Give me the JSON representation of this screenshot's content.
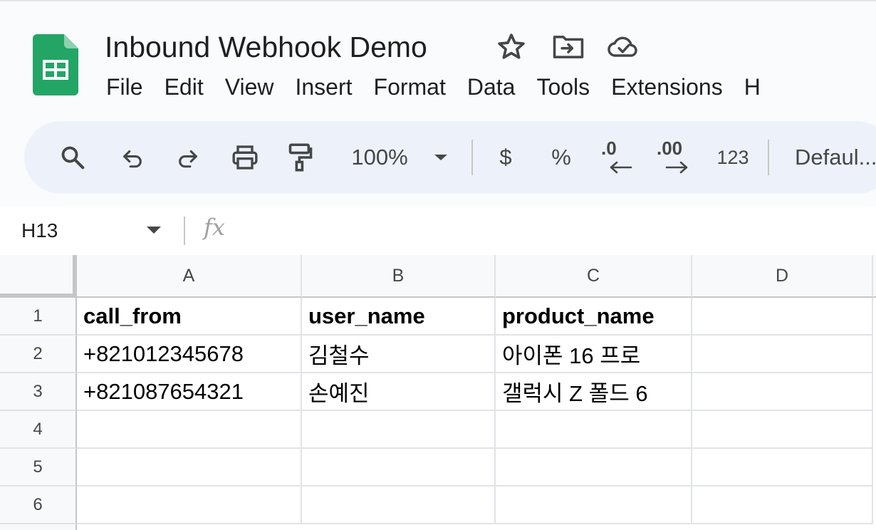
{
  "document": {
    "title": "Inbound Webhook Demo"
  },
  "title_icons": [
    "star-icon",
    "move-to-folder-icon",
    "cloud-saved-icon"
  ],
  "menu": [
    "File",
    "Edit",
    "View",
    "Insert",
    "Format",
    "Data",
    "Tools",
    "Extensions",
    "H"
  ],
  "toolbar": {
    "zoom": "100%",
    "currency": "$",
    "percent": "%",
    "decrease_decimal": ".0",
    "increase_decimal": ".00",
    "number_format": "123",
    "font": "Defaul..."
  },
  "formula_bar": {
    "cell_ref": "H13",
    "fx": "fx"
  },
  "columns": [
    "A",
    "B",
    "C",
    "D"
  ],
  "rows": [
    "1",
    "2",
    "3",
    "4",
    "5",
    "6"
  ],
  "cells": [
    [
      "call_from",
      "user_name",
      "product_name",
      ""
    ],
    [
      "+821012345678",
      "김철수",
      "아이폰 16 프로",
      ""
    ],
    [
      "+821087654321",
      "손예진",
      "갤럭시 Z 폴드 6",
      ""
    ],
    [
      "",
      "",
      "",
      ""
    ],
    [
      "",
      "",
      "",
      ""
    ],
    [
      "",
      "",
      "",
      ""
    ]
  ],
  "colors": {
    "brand_green": "#23a566",
    "toolbar_bg": "#edf2fa"
  }
}
